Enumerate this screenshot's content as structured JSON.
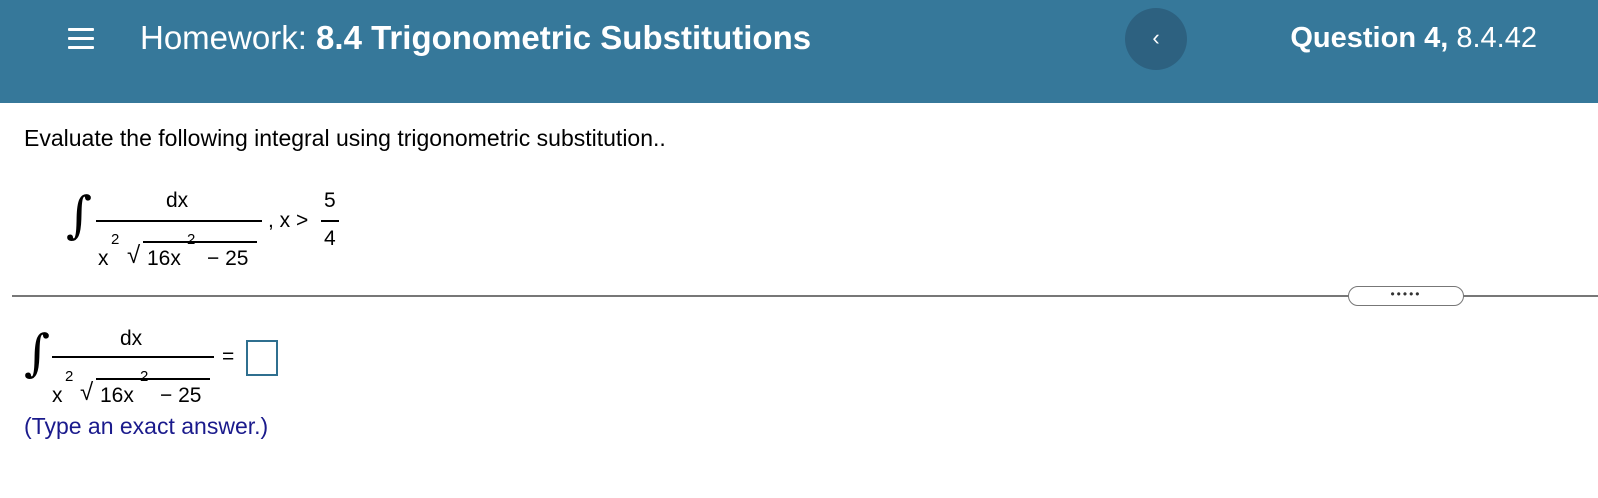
{
  "header": {
    "homework_prefix": "Homework:",
    "homework_name": "8.4 Trigonometric Substitutions",
    "prev_label": "‹",
    "question_label": "Question 4,",
    "question_id": "8.4.42"
  },
  "instructions": "Evaluate the following integral using trigonometric substitution..",
  "problem": {
    "integral_sign": "∫",
    "numerator": "dx",
    "x_base": "x",
    "exp": "2",
    "radicand_coef": "16x",
    "radicand_rest": "− 25",
    "radical": "√",
    "condition": ", x >",
    "bound_num": "5",
    "bound_den": "4"
  },
  "more_label": "•••••",
  "answer": {
    "integral_sign": "∫",
    "numerator": "dx",
    "x_base": "x",
    "exp": "2",
    "radicand_coef": "16x",
    "radicand_rest": "− 25",
    "radical": "√",
    "equals": "=",
    "value": ""
  },
  "hint": "(Type an exact answer.)",
  "colors": {
    "header_bg": "#36789a",
    "prev_btn_bg": "#2d6180",
    "hint_text": "#1a1a8c",
    "answer_border": "#2f6f8f"
  }
}
